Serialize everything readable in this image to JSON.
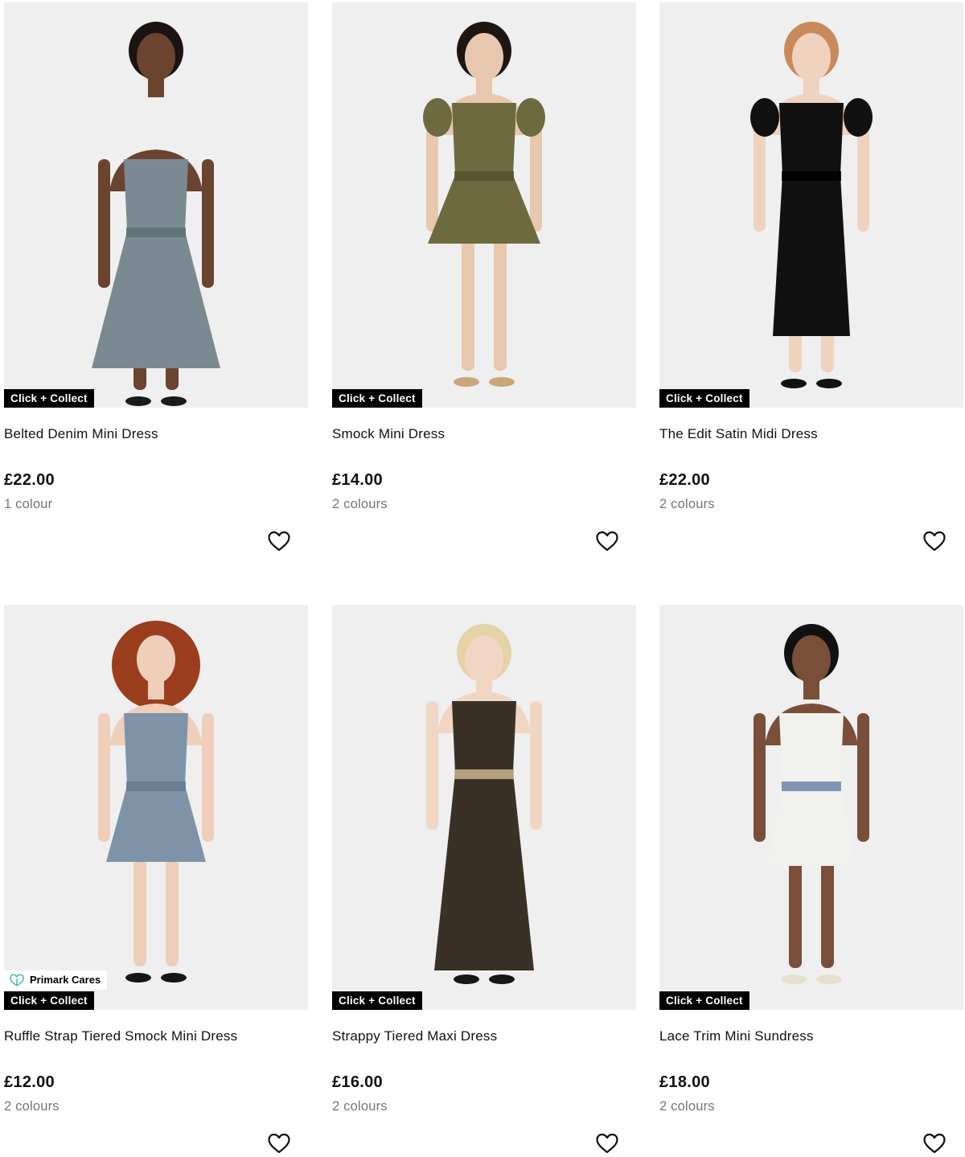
{
  "products": [
    {
      "title": "Belted Denim Mini Dress",
      "price": "£22.00",
      "colours": "1 colour",
      "badge": "Click + Collect",
      "image_icon": "product-photo",
      "colors": {
        "skin": "#6b4430",
        "hair": "#1a1412",
        "dress": "#7b8a92",
        "dress_dark": "#5e6d74",
        "shoe": "#1a1a1a"
      }
    },
    {
      "title": "Smock Mini Dress",
      "price": "£14.00",
      "colours": "2 colours",
      "badge": "Click + Collect",
      "image_icon": "product-photo",
      "colors": {
        "skin": "#e7c8ae",
        "hair": "#1d1613",
        "dress": "#6d6a3f",
        "dress_dark": "#56532f",
        "shoe": "#c9a77b"
      }
    },
    {
      "title": "The Edit Satin Midi Dress",
      "price": "£22.00",
      "colours": "2 colours",
      "badge": "Click + Collect",
      "image_icon": "product-photo",
      "colors": {
        "skin": "#efd3bf",
        "hair": "#c98a5b",
        "dress": "#111111",
        "dress_dark": "#000000",
        "shoe": "#111111"
      }
    },
    {
      "title": "Ruffle Strap Tiered Smock Mini Dress",
      "price": "£12.00",
      "colours": "2 colours",
      "badge": "Click + Collect",
      "badge_cares": "Primark Cares",
      "image_icon": "product-photo",
      "colors": {
        "skin": "#efcfba",
        "hair": "#9a3e1e",
        "dress": "#7f93a8",
        "dress_dark": "#667a8f",
        "shoe": "#151515"
      }
    },
    {
      "title": "Strappy Tiered Maxi Dress",
      "price": "£16.00",
      "colours": "2 colours",
      "badge": "Click + Collect",
      "image_icon": "product-photo",
      "colors": {
        "skin": "#f1d6c4",
        "hair": "#e3d3a5",
        "dress": "#3a3126",
        "dress_dark": "#c9b48c",
        "shoe": "#161616"
      }
    },
    {
      "title": "Lace Trim Mini Sundress",
      "price": "£18.00",
      "colours": "2 colours",
      "badge": "Click + Collect",
      "image_icon": "product-photo",
      "colors": {
        "skin": "#7a4f39",
        "hair": "#111111",
        "dress": "#f1f1ee",
        "dress_dark": "#6c86a8",
        "shoe": "#e6e0cf"
      }
    }
  ],
  "icons": {
    "wishlist": "heart-outline-icon",
    "cares": "heart-leaf-icon"
  },
  "theme": {
    "badge_bg": "#000000",
    "badge_text": "#ffffff",
    "muted_text": "#767676",
    "cares_accent": "#4bb8b0"
  }
}
